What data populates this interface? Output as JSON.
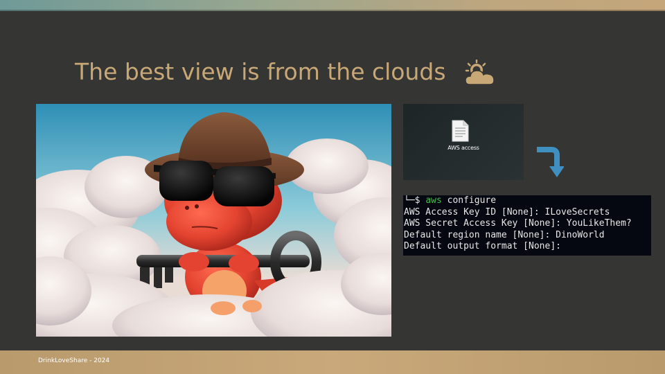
{
  "slide": {
    "title": "The best view is from the clouds",
    "footer": "DrinkLoveShare - 2024",
    "icons": {
      "title_icon": "sun-behind-cloud-icon",
      "flow_arrow": "curved-down-arrow-icon",
      "file": "text-file-icon"
    },
    "colors": {
      "background": "#353533",
      "title": "#c8a877",
      "band": "#c4a67a",
      "arrow": "#3f8fc0",
      "terminal_bg": "#050810",
      "terminal_green": "#3fbf4a"
    }
  },
  "image": {
    "alt": "Red cartoon dinosaur with brown fedora and sunglasses holding a large key, sitting on clouds"
  },
  "desktop": {
    "file_label": "AWS access"
  },
  "terminal": {
    "prompt": "└─$ ",
    "command_name": "aws",
    "command_arg": " configure",
    "lines": [
      "AWS Access Key ID [None]: ILoveSecrets",
      "AWS Secret Access Key [None]: YouLikeThem?",
      "Default region name [None]: DinoWorld",
      "Default output format [None]:"
    ]
  }
}
